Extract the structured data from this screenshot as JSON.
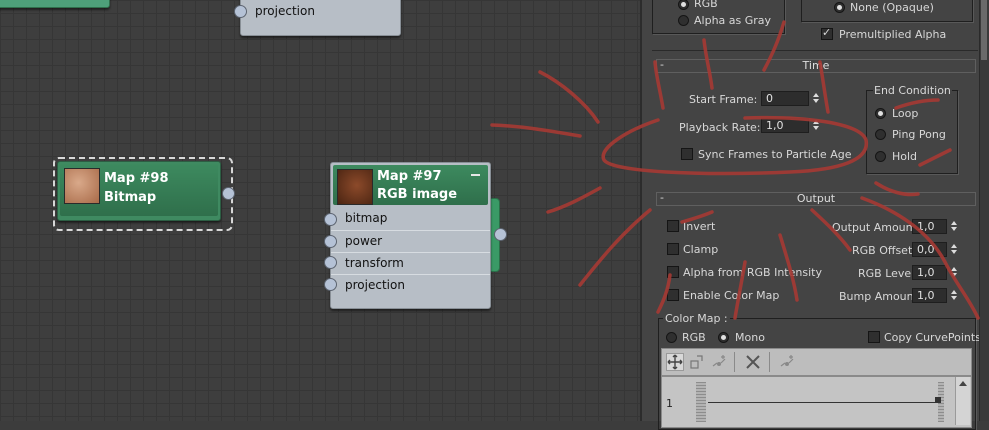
{
  "nodes": {
    "top_node": {
      "slot": "projection"
    },
    "map98": {
      "line1": "Map #98",
      "line2": "Bitmap"
    },
    "map97": {
      "line1": "Map #97",
      "line2": "RGB image",
      "slots": [
        "bitmap",
        "power",
        "transform",
        "projection"
      ]
    }
  },
  "panel": {
    "alpha_source": {
      "rgb": "RGB",
      "alpha_as_gray": "Alpha as Gray",
      "none_opaque": "None (Opaque)",
      "premultiplied": "Premultiplied Alpha"
    },
    "time": {
      "title": "Time",
      "start_frame_label": "Start Frame:",
      "start_frame_value": "0",
      "playback_rate_label": "Playback Rate:",
      "playback_rate_value": "1,0",
      "sync_label": "Sync Frames to Particle Age",
      "end_condition_label": "End Condition",
      "loop": "Loop",
      "ping_pong": "Ping Pong",
      "hold": "Hold"
    },
    "output": {
      "title": "Output",
      "invert": "Invert",
      "clamp": "Clamp",
      "alpha_from_rgb": "Alpha from RGB Intensity",
      "enable_color_map": "Enable Color Map",
      "output_amount_label": "Output Amount:",
      "output_amount_value": "1,0",
      "rgb_offset_label": "RGB Offset:",
      "rgb_offset_value": "0,0",
      "rgb_level_label": "RGB Level:",
      "rgb_level_value": "1,0",
      "bump_amount_label": "Bump Amount:",
      "bump_amount_value": "1,0",
      "color_map_label": "Color Map :",
      "rgb": "RGB",
      "mono": "Mono",
      "copy_curve_points": "Copy CurvePoints",
      "curve_axis_value": "1"
    }
  },
  "colors": {
    "node_header": "#2f6f4b",
    "scribble": "#a63a34"
  }
}
